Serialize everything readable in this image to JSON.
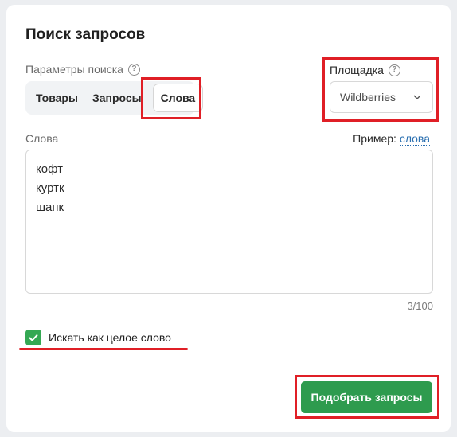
{
  "form": {
    "title": "Поиск запросов",
    "search_params_label": "Параметры поиска",
    "search_params_help": "?",
    "tabs": [
      {
        "label": "Товары",
        "active": false
      },
      {
        "label": "Запросы",
        "active": false
      },
      {
        "label": "Слова",
        "active": true
      }
    ],
    "platform_label": "Площадка",
    "platform_help": "?",
    "platform_value": "Wildberries",
    "words_label": "Слова",
    "example_prefix": "Пример:",
    "example_link": "слова",
    "words_value": "кофт\nкуртк\nшапк",
    "counter": "3/100",
    "whole_word_label": "Искать как целое слово",
    "whole_word_checked": true,
    "submit_label": "Подобрать запросы"
  },
  "colors": {
    "accent_green": "#2e9b4e",
    "checkbox_green": "#34a853",
    "link_blue": "#2a6fb0",
    "highlight_red": "#e01f26"
  },
  "icons": {
    "help": "question-circle-icon",
    "select": "chevron-down-icon",
    "checkbox": "checkmark-icon"
  }
}
